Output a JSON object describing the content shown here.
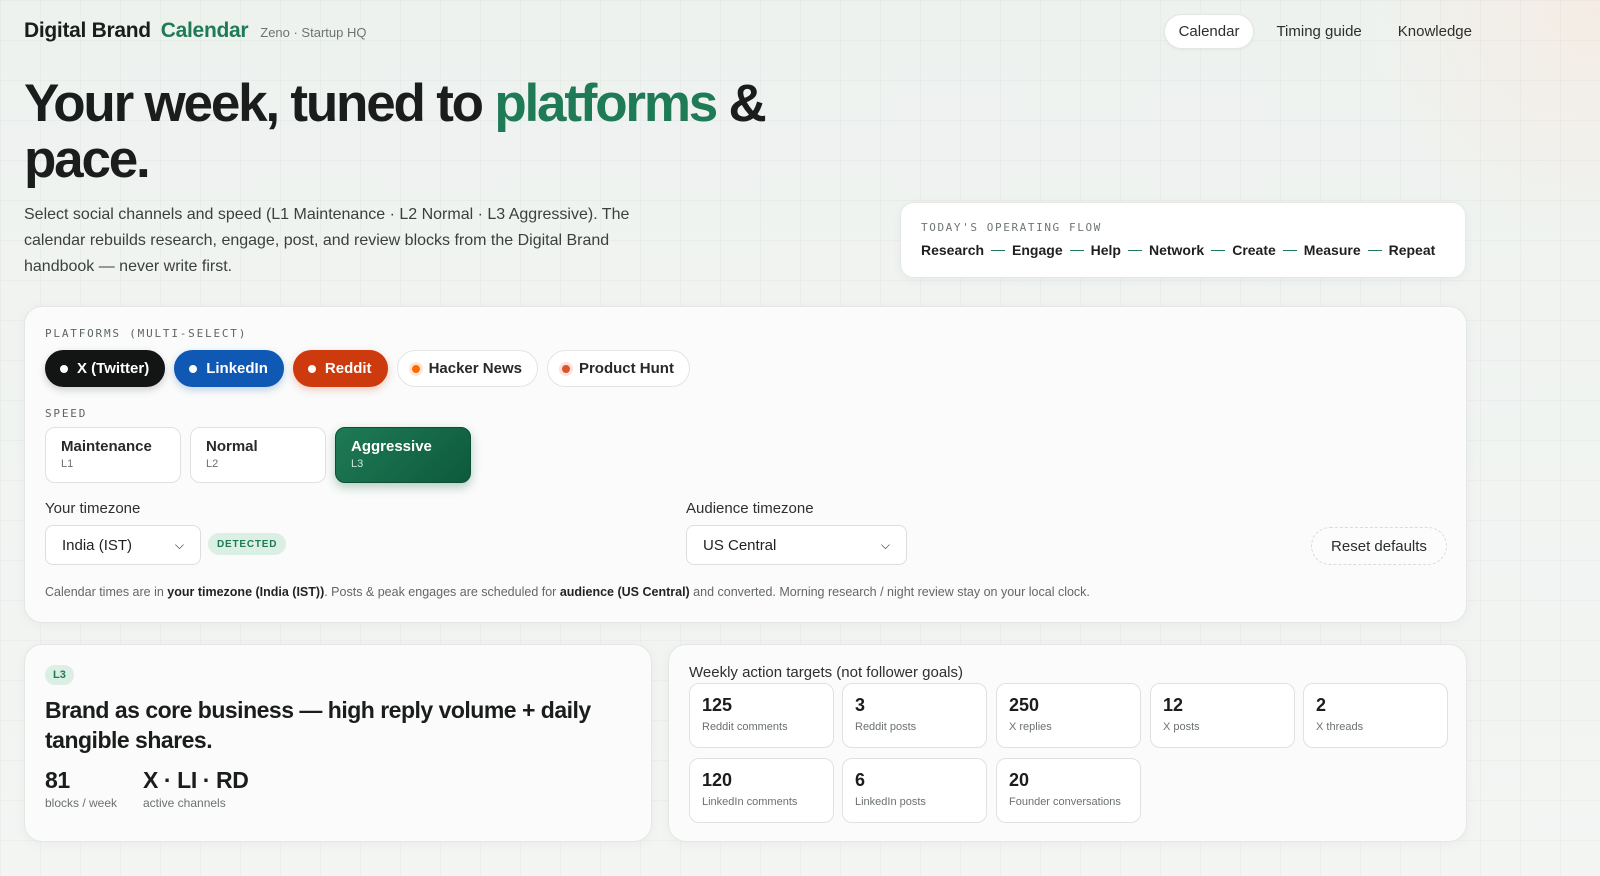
{
  "header": {
    "brand_main": "Digital Brand",
    "brand_accent": "Calendar",
    "brand_sub": "Zeno · Startup HQ",
    "nav": [
      {
        "label": "Calendar",
        "active": true
      },
      {
        "label": "Timing guide",
        "active": false
      },
      {
        "label": "Knowledge",
        "active": false
      }
    ]
  },
  "hero": {
    "title_part1": "Your week, tuned to ",
    "title_accent": "platforms",
    "title_part2": " & pace.",
    "description": "Select social channels and speed (L1 Maintenance · L2 Normal · L3 Aggressive). The calendar rebuilds research, engage, post, and review blocks from the Digital Brand handbook — never write first."
  },
  "flow": {
    "label": "TODAY'S OPERATING FLOW",
    "steps": [
      "Research",
      "Engage",
      "Help",
      "Network",
      "Create",
      "Measure",
      "Repeat"
    ]
  },
  "controls": {
    "platforms_label": "PLATFORMS (MULTI-SELECT)",
    "platforms": [
      {
        "label": "X (Twitter)",
        "selected": true,
        "color": "#131514"
      },
      {
        "label": "LinkedIn",
        "selected": true,
        "color": "#0f58b4"
      },
      {
        "label": "Reddit",
        "selected": true,
        "color": "#cc3a0e"
      },
      {
        "label": "Hacker News",
        "selected": false,
        "color": "#ff6a00"
      },
      {
        "label": "Product Hunt",
        "selected": false,
        "color": "#da552f"
      }
    ],
    "speed_label": "SPEED",
    "speeds": [
      {
        "title": "Maintenance",
        "level": "L1",
        "active": false
      },
      {
        "title": "Normal",
        "level": "L2",
        "active": false
      },
      {
        "title": "Aggressive",
        "level": "L3",
        "active": true
      }
    ],
    "your_tz_label": "Your timezone",
    "your_tz_value": "India (IST)",
    "detected_badge": "DETECTED",
    "audience_tz_label": "Audience timezone",
    "audience_tz_value": "US Central",
    "reset_label": "Reset defaults",
    "note": {
      "t1": "Calendar times are in ",
      "b1": "your timezone (India (IST))",
      "t2": ". Posts & peak engages are scheduled for ",
      "b2": "audience (US Central)",
      "t3": " and converted. Morning research / night review stay on your local clock."
    }
  },
  "level": {
    "badge": "L3",
    "headline": "Brand as core business — high reply volume + daily tangible shares.",
    "stats": [
      {
        "num": "81",
        "label": "blocks / week"
      },
      {
        "num": "X · LI · RD",
        "label": "active channels"
      }
    ]
  },
  "targets": {
    "title": "Weekly action targets (not follower goals)",
    "items": [
      {
        "num": "125",
        "label": "Reddit comments"
      },
      {
        "num": "3",
        "label": "Reddit posts"
      },
      {
        "num": "250",
        "label": "X replies"
      },
      {
        "num": "12",
        "label": "X posts"
      },
      {
        "num": "2",
        "label": "X threads"
      },
      {
        "num": "120",
        "label": "LinkedIn comments"
      },
      {
        "num": "6",
        "label": "LinkedIn posts"
      },
      {
        "num": "20",
        "label": "Founder conversations"
      }
    ]
  },
  "colors": {
    "accent": "#1f7a56",
    "linkedin": "#0f58b4",
    "reddit": "#cc3a0e"
  }
}
